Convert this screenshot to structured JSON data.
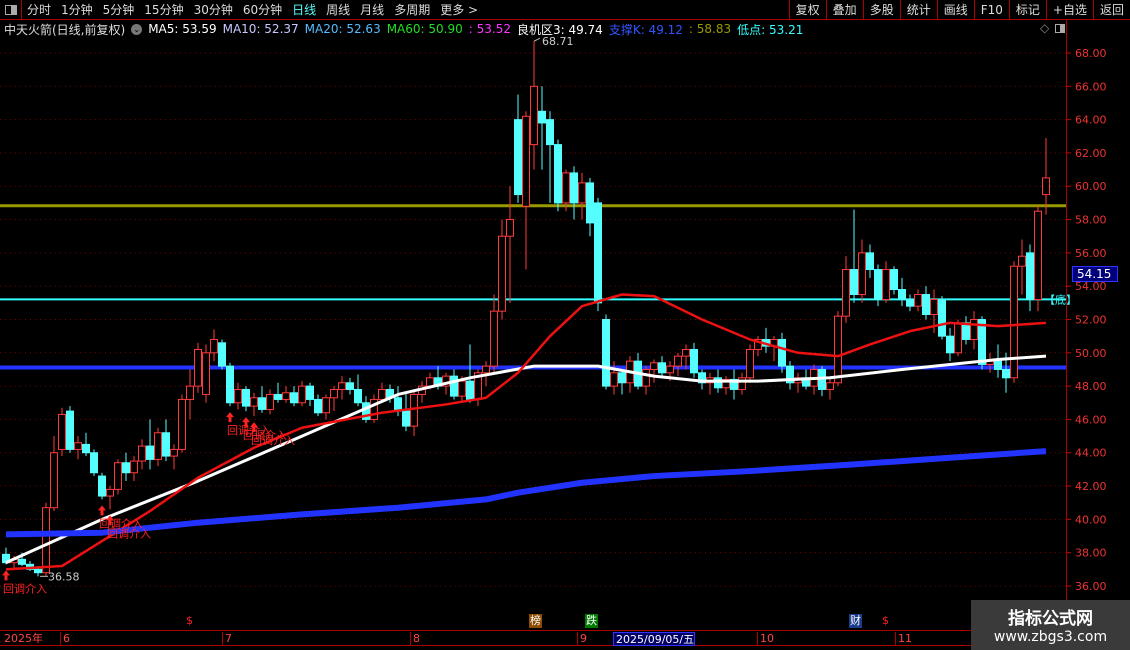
{
  "toolbar": {
    "periods": [
      "分时",
      "1分钟",
      "5分钟",
      "15分钟",
      "30分钟",
      "60分钟",
      "日线",
      "周线",
      "月线",
      "多周期",
      "更多 >"
    ],
    "active_period": "日线",
    "buttons": [
      "复权",
      "叠加",
      "多股",
      "统计",
      "画线",
      "F10",
      "标记",
      "+自选",
      "返回"
    ]
  },
  "info": {
    "title": "中天火箭(日线,前复权)",
    "ma5": "MA5: 53.59",
    "ma10": "MA10: 52.37",
    "ma20": "MA20: 52.63",
    "ma60": "MA60: 50.90",
    "magenta": ": 53.52",
    "zone": "良机区3: 49.74",
    "support": "支撑K: 49.12",
    "olive": ": 58.83",
    "low": "低点: 53.21",
    "colors": {
      "ma5": "#ffffff",
      "ma10": "#c8c8ff",
      "ma20": "#55bbff",
      "ma60": "#22dd22",
      "magenta": "#ff33ff",
      "zone": "#ffffff",
      "support": "#3355ff",
      "olive": "#999900",
      "low": "#33ffff"
    }
  },
  "chart_data": {
    "type": "candlestick",
    "ylim": [
      35,
      69
    ],
    "yticks": [
      "36.00",
      "38.00",
      "40.00",
      "42.00",
      "44.00",
      "46.00",
      "48.00",
      "50.00",
      "52.00",
      "54.00",
      "56.00",
      "58.00",
      "60.00",
      "62.00",
      "64.00",
      "66.00",
      "68.00"
    ],
    "last_price": "54.15",
    "high_label": "68.71",
    "low_label": "36.58",
    "hlines": [
      {
        "name": "olive",
        "value": 58.83,
        "color": "#999900"
      },
      {
        "name": "low-point",
        "value": 53.21,
        "color": "#33ffff"
      },
      {
        "name": "support",
        "value": 49.12,
        "color": "#2233ff"
      }
    ],
    "bottom_label": "【底】",
    "signal_label": "回调介入",
    "signals": [
      0,
      12,
      13,
      28,
      30,
      31
    ],
    "candles": [
      [
        37.9,
        38.3,
        37.3,
        37.4
      ],
      [
        37.4,
        37.8,
        37.0,
        37.6
      ],
      [
        37.6,
        38.0,
        37.2,
        37.3
      ],
      [
        37.3,
        37.5,
        36.9,
        37.0
      ],
      [
        37.0,
        37.2,
        36.58,
        36.8
      ],
      [
        36.8,
        41.0,
        36.6,
        40.7
      ],
      [
        40.7,
        45.0,
        40.5,
        44.0
      ],
      [
        44.2,
        46.7,
        43.8,
        46.3
      ],
      [
        46.5,
        46.8,
        44.0,
        44.2
      ],
      [
        44.2,
        45.0,
        43.6,
        44.6
      ],
      [
        44.5,
        45.2,
        43.8,
        44.0
      ],
      [
        44.0,
        44.2,
        42.6,
        42.8
      ],
      [
        42.6,
        42.8,
        41.2,
        41.4
      ],
      [
        41.4,
        42.0,
        40.6,
        41.8
      ],
      [
        41.8,
        43.6,
        41.5,
        43.4
      ],
      [
        43.4,
        44.0,
        42.3,
        42.8
      ],
      [
        42.8,
        43.8,
        42.3,
        43.5
      ],
      [
        43.5,
        44.8,
        43.0,
        44.4
      ],
      [
        44.4,
        46.0,
        43.0,
        43.6
      ],
      [
        43.6,
        45.5,
        43.2,
        45.2
      ],
      [
        45.2,
        46.0,
        43.5,
        43.8
      ],
      [
        43.8,
        44.5,
        43.0,
        44.2
      ],
      [
        44.2,
        47.5,
        44.0,
        47.2
      ],
      [
        47.2,
        49.0,
        46.0,
        48.0
      ],
      [
        48.0,
        50.6,
        47.6,
        50.2
      ],
      [
        47.5,
        50.5,
        47.0,
        50.0
      ],
      [
        50.0,
        51.4,
        49.5,
        50.8
      ],
      [
        50.6,
        50.8,
        49.0,
        49.2
      ],
      [
        49.2,
        49.4,
        46.8,
        47.0
      ],
      [
        47.0,
        48.2,
        46.6,
        47.8
      ],
      [
        47.8,
        48.0,
        46.5,
        46.8
      ],
      [
        46.8,
        47.6,
        46.2,
        47.3
      ],
      [
        47.3,
        48.0,
        46.4,
        46.6
      ],
      [
        46.6,
        47.8,
        46.3,
        47.5
      ],
      [
        47.5,
        48.2,
        47.0,
        47.2
      ],
      [
        47.2,
        48.0,
        47.0,
        47.6
      ],
      [
        47.6,
        48.0,
        46.8,
        47.0
      ],
      [
        47.0,
        48.3,
        46.8,
        48.0
      ],
      [
        48.0,
        48.2,
        46.8,
        47.2
      ],
      [
        47.2,
        47.5,
        46.2,
        46.4
      ],
      [
        46.4,
        47.5,
        46.0,
        47.3
      ],
      [
        47.3,
        48.0,
        46.5,
        47.8
      ],
      [
        47.8,
        48.6,
        47.2,
        48.2
      ],
      [
        48.2,
        48.5,
        47.5,
        47.8
      ],
      [
        47.8,
        48.7,
        46.8,
        47.0
      ],
      [
        47.0,
        47.4,
        45.8,
        46.0
      ],
      [
        46.0,
        47.5,
        45.8,
        47.2
      ],
      [
        47.2,
        48.2,
        47.0,
        47.8
      ],
      [
        47.8,
        48.1,
        47.0,
        47.3
      ],
      [
        47.3,
        48.0,
        46.2,
        46.5
      ],
      [
        46.5,
        47.6,
        45.3,
        45.6
      ],
      [
        45.6,
        47.8,
        45.0,
        47.5
      ],
      [
        47.5,
        48.3,
        47.0,
        48.0
      ],
      [
        48.0,
        48.8,
        47.8,
        48.5
      ],
      [
        48.5,
        49.2,
        47.8,
        48.0
      ],
      [
        48.0,
        48.8,
        47.5,
        48.6
      ],
      [
        48.6,
        49.0,
        47.2,
        47.4
      ],
      [
        47.4,
        48.6,
        47.0,
        48.3
      ],
      [
        48.3,
        50.5,
        47.0,
        47.2
      ],
      [
        47.2,
        49.0,
        46.8,
        48.8
      ],
      [
        48.8,
        49.5,
        48.0,
        49.2
      ],
      [
        49.2,
        53.5,
        48.8,
        52.5
      ],
      [
        52.5,
        58.0,
        52.0,
        57.0
      ],
      [
        57.0,
        60.0,
        53.0,
        58.0
      ],
      [
        64.0,
        65.5,
        59.0,
        59.5
      ],
      [
        58.8,
        64.5,
        55.0,
        64.2
      ],
      [
        62.5,
        68.71,
        61.0,
        66.0
      ],
      [
        64.5,
        66.0,
        61.0,
        63.8
      ],
      [
        64.0,
        64.5,
        59.0,
        62.5
      ],
      [
        62.5,
        62.8,
        58.5,
        59.0
      ],
      [
        59.0,
        61.0,
        58.5,
        60.8
      ],
      [
        60.8,
        61.2,
        58.0,
        59.0
      ],
      [
        59.0,
        60.8,
        58.0,
        60.2
      ],
      [
        60.2,
        60.5,
        57.0,
        57.8
      ],
      [
        59.0,
        59.3,
        52.5,
        53.0
      ],
      [
        52.0,
        52.3,
        47.8,
        48.0
      ],
      [
        48.0,
        49.5,
        47.5,
        48.8
      ],
      [
        48.8,
        49.0,
        47.5,
        48.2
      ],
      [
        48.2,
        49.8,
        47.6,
        49.5
      ],
      [
        49.5,
        50.0,
        47.8,
        48.0
      ],
      [
        48.0,
        49.2,
        47.5,
        49.0
      ],
      [
        49.0,
        49.6,
        48.2,
        49.4
      ],
      [
        49.4,
        49.8,
        48.5,
        48.8
      ],
      [
        48.8,
        49.5,
        48.3,
        49.2
      ],
      [
        49.2,
        50.0,
        48.6,
        49.8
      ],
      [
        49.8,
        50.5,
        49.0,
        50.2
      ],
      [
        50.2,
        50.6,
        48.5,
        48.8
      ],
      [
        48.8,
        49.0,
        47.8,
        48.2
      ],
      [
        48.2,
        48.8,
        47.5,
        48.5
      ],
      [
        48.5,
        49.0,
        47.6,
        47.9
      ],
      [
        47.9,
        48.6,
        47.5,
        48.4
      ],
      [
        48.4,
        49.0,
        47.2,
        47.8
      ],
      [
        47.8,
        48.8,
        47.5,
        48.5
      ],
      [
        48.5,
        50.5,
        48.2,
        50.2
      ],
      [
        50.2,
        51.0,
        49.8,
        50.8
      ],
      [
        50.8,
        51.5,
        50.0,
        50.4
      ],
      [
        50.4,
        51.0,
        49.5,
        50.8
      ],
      [
        50.8,
        51.2,
        48.8,
        49.2
      ],
      [
        49.2,
        49.5,
        47.8,
        48.2
      ],
      [
        48.2,
        48.8,
        47.6,
        48.5
      ],
      [
        48.5,
        49.0,
        47.8,
        48.0
      ],
      [
        48.0,
        49.3,
        47.5,
        49.0
      ],
      [
        49.0,
        49.2,
        47.4,
        47.8
      ],
      [
        47.8,
        48.5,
        47.2,
        48.2
      ],
      [
        48.2,
        52.5,
        48.0,
        52.2
      ],
      [
        52.2,
        55.8,
        51.8,
        55.0
      ],
      [
        55.0,
        58.6,
        53.0,
        53.5
      ],
      [
        53.5,
        56.8,
        53.0,
        56.0
      ],
      [
        56.0,
        56.5,
        54.5,
        55.0
      ],
      [
        55.0,
        55.3,
        52.8,
        53.2
      ],
      [
        53.2,
        55.5,
        53.0,
        55.0
      ],
      [
        55.0,
        55.2,
        53.5,
        53.8
      ],
      [
        53.8,
        54.5,
        52.8,
        53.2
      ],
      [
        53.2,
        53.5,
        52.5,
        52.8
      ],
      [
        52.8,
        53.8,
        52.5,
        53.5
      ],
      [
        53.5,
        54.0,
        52.0,
        52.3
      ],
      [
        52.3,
        53.8,
        51.2,
        53.2
      ],
      [
        53.2,
        53.4,
        50.8,
        51.0
      ],
      [
        51.0,
        51.5,
        49.5,
        50.0
      ],
      [
        50.0,
        52.0,
        49.8,
        51.8
      ],
      [
        51.8,
        52.2,
        50.5,
        50.8
      ],
      [
        50.8,
        52.5,
        50.2,
        52.0
      ],
      [
        52.0,
        52.2,
        49.0,
        49.3
      ],
      [
        49.3,
        50.0,
        48.8,
        49.5
      ],
      [
        49.5,
        50.5,
        48.5,
        49.0
      ],
      [
        49.0,
        50.0,
        47.6,
        48.5
      ],
      [
        48.5,
        55.5,
        48.2,
        55.2
      ],
      [
        55.2,
        56.8,
        53.5,
        55.8
      ],
      [
        56.0,
        56.5,
        52.5,
        53.2
      ],
      [
        53.2,
        58.8,
        52.5,
        58.5
      ],
      [
        59.5,
        62.9,
        58.3,
        60.5
      ]
    ],
    "lines": [
      {
        "name": "white-ma",
        "color": "#ffffff",
        "width": 3,
        "points": [
          [
            0,
            37.4
          ],
          [
            12,
            40
          ],
          [
            24,
            42.3
          ],
          [
            37,
            45
          ],
          [
            49,
            47.5
          ],
          [
            58,
            48.5
          ],
          [
            66,
            49.2
          ],
          [
            74,
            49.2
          ],
          [
            81,
            48.6
          ],
          [
            87,
            48.3
          ],
          [
            94,
            48.3
          ],
          [
            103,
            48.5
          ],
          [
            112,
            49
          ],
          [
            118,
            49.3
          ],
          [
            124,
            49.6
          ],
          [
            130,
            49.8
          ]
        ]
      },
      {
        "name": "red-ma",
        "color": "#ee1111",
        "width": 2.5,
        "points": [
          [
            0,
            37
          ],
          [
            7,
            37.2
          ],
          [
            12,
            38.7
          ],
          [
            18,
            40.5
          ],
          [
            24,
            42.5
          ],
          [
            31,
            44.3
          ],
          [
            37,
            45.5
          ],
          [
            47,
            46.4
          ],
          [
            55,
            46.9
          ],
          [
            60,
            47.3
          ],
          [
            64,
            48.8
          ],
          [
            68,
            51
          ],
          [
            72,
            52.8
          ],
          [
            77,
            53.5
          ],
          [
            81,
            53.4
          ],
          [
            87,
            52
          ],
          [
            93,
            50.8
          ],
          [
            99,
            50
          ],
          [
            104,
            49.8
          ],
          [
            108,
            50.5
          ],
          [
            113,
            51.3
          ],
          [
            118,
            51.8
          ],
          [
            124,
            51.6
          ],
          [
            130,
            51.8
          ]
        ]
      },
      {
        "name": "blue-ma",
        "color": "#2233ff",
        "width": 6,
        "points": [
          [
            0,
            39.1
          ],
          [
            12,
            39.2
          ],
          [
            24,
            39.8
          ],
          [
            37,
            40.3
          ],
          [
            49,
            40.7
          ],
          [
            60,
            41.2
          ],
          [
            64,
            41.6
          ],
          [
            72,
            42.2
          ],
          [
            81,
            42.6
          ],
          [
            93,
            42.9
          ],
          [
            106,
            43.3
          ],
          [
            118,
            43.7
          ],
          [
            130,
            44.1
          ]
        ]
      }
    ]
  },
  "markers": [
    {
      "text": "$",
      "idx": 23,
      "bg": "",
      "color": "#ff2222"
    },
    {
      "text": "榜",
      "idx": 66,
      "bg": "#8a4a00",
      "color": "#ffffff"
    },
    {
      "text": "跌",
      "idx": 73,
      "bg": "#007a00",
      "color": "#ffffff"
    },
    {
      "text": "财",
      "idx": 106,
      "bg": "#1a3a8a",
      "color": "#ffffff"
    },
    {
      "text": "$",
      "idx": 110,
      "bg": "",
      "color": "#ff2222"
    }
  ],
  "timeaxis": [
    {
      "label": "2025年",
      "x": "a"
    },
    {
      "label": "6"
    },
    {
      "label": "7"
    },
    {
      "label": "8"
    },
    {
      "label": "9"
    },
    {
      "label": "2025/09/05/五",
      "highlight": true
    },
    {
      "label": "10"
    },
    {
      "label": "11"
    }
  ],
  "watermark": {
    "title": "指标公式网",
    "url": "www.zbgs3.com"
  }
}
